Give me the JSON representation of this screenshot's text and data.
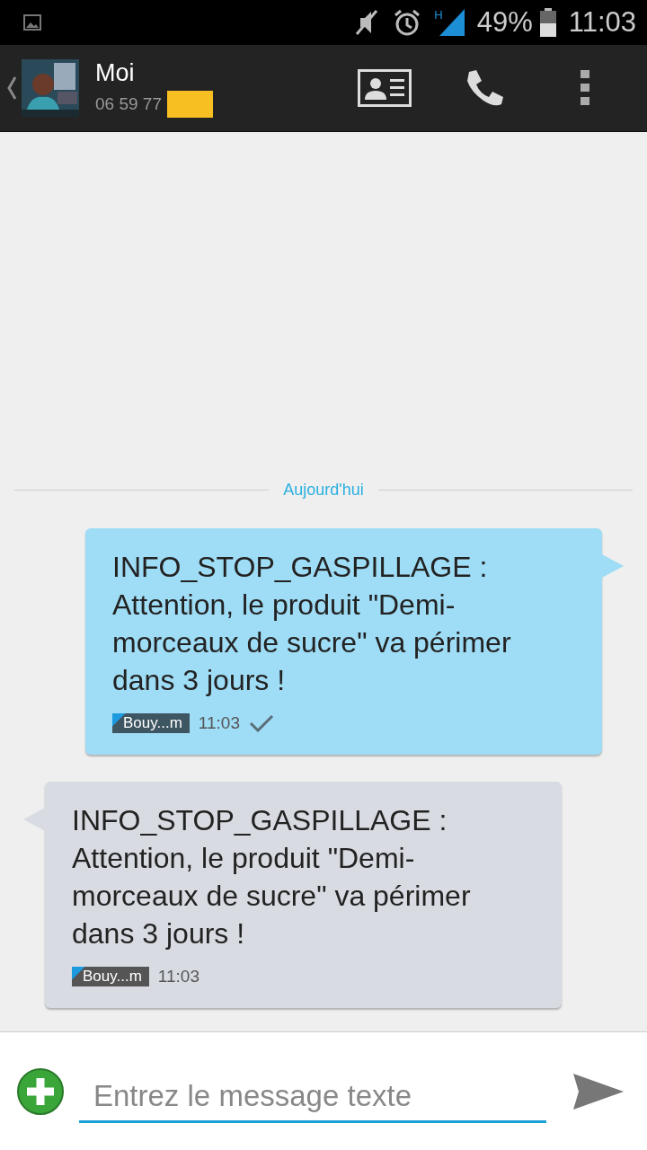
{
  "status_bar": {
    "network": "H",
    "battery": "49%",
    "time": "11:03"
  },
  "header": {
    "name": "Moi",
    "number": "06 59 77"
  },
  "date_divider": "Aujourd'hui",
  "messages": [
    {
      "kind": "sent",
      "text": "INFO_STOP_GASPILLAGE : Attention, le produit \"Demi-morceaux de sucre\" va périmer dans 3 jours !",
      "sim": "Bouy...m",
      "time": "11:03",
      "delivered": true
    },
    {
      "kind": "received",
      "text": "INFO_STOP_GASPILLAGE : Attention, le produit \"Demi-morceaux de sucre\" va périmer dans 3 jours !",
      "sim": "Bouy...m",
      "time": "11:03",
      "delivered": false
    }
  ],
  "composer": {
    "placeholder": "Entrez le message texte"
  }
}
